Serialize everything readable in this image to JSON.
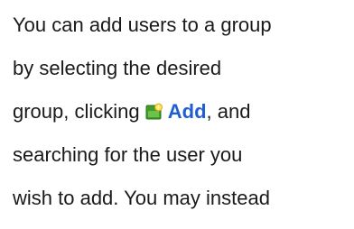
{
  "document": {
    "line1": "You can add users to a group",
    "line2": "by selecting the desired",
    "line3_before": "group, clicking ",
    "add_label": "Add",
    "line3_after": ", and",
    "line4": "searching for the user you",
    "line5": "wish to add. You may instead",
    "icon": "add-user-icon"
  }
}
